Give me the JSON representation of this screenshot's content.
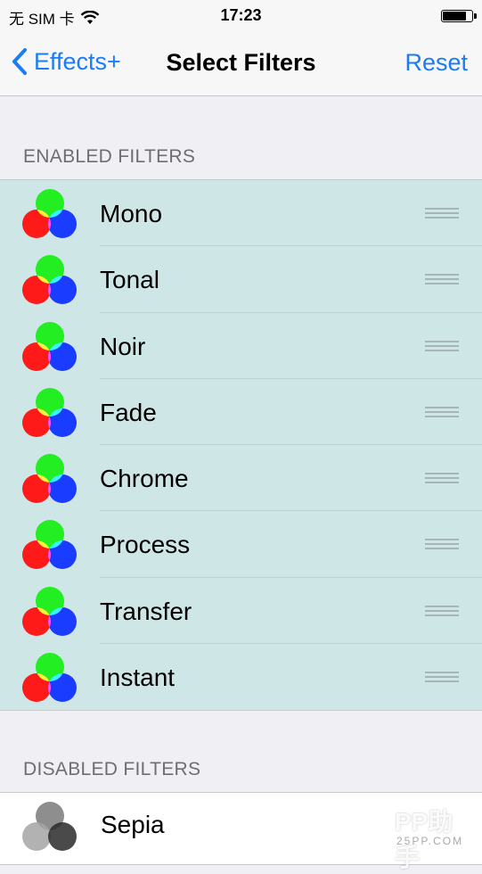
{
  "status_bar": {
    "carrier": "无 SIM 卡",
    "time": "17:23",
    "battery_level": 0.85
  },
  "nav": {
    "back_label": "Effects+",
    "title": "Select Filters",
    "reset_label": "Reset"
  },
  "sections": {
    "enabled_header": "ENABLED FILTERS",
    "disabled_header": "DISABLED FILTERS"
  },
  "enabled_filters": [
    "Mono",
    "Tonal",
    "Noir",
    "Fade",
    "Chrome",
    "Process",
    "Transfer",
    "Instant"
  ],
  "disabled_filters": [
    "Sepia"
  ],
  "watermark": {
    "brand": "PP助手",
    "site": "25PP.COM"
  },
  "colors": {
    "accent": "#1a7cf6",
    "enabled_bg": "#cfe6e6",
    "red": "#ff1a1a",
    "green": "#22ee22",
    "blue": "#1a3cff"
  }
}
